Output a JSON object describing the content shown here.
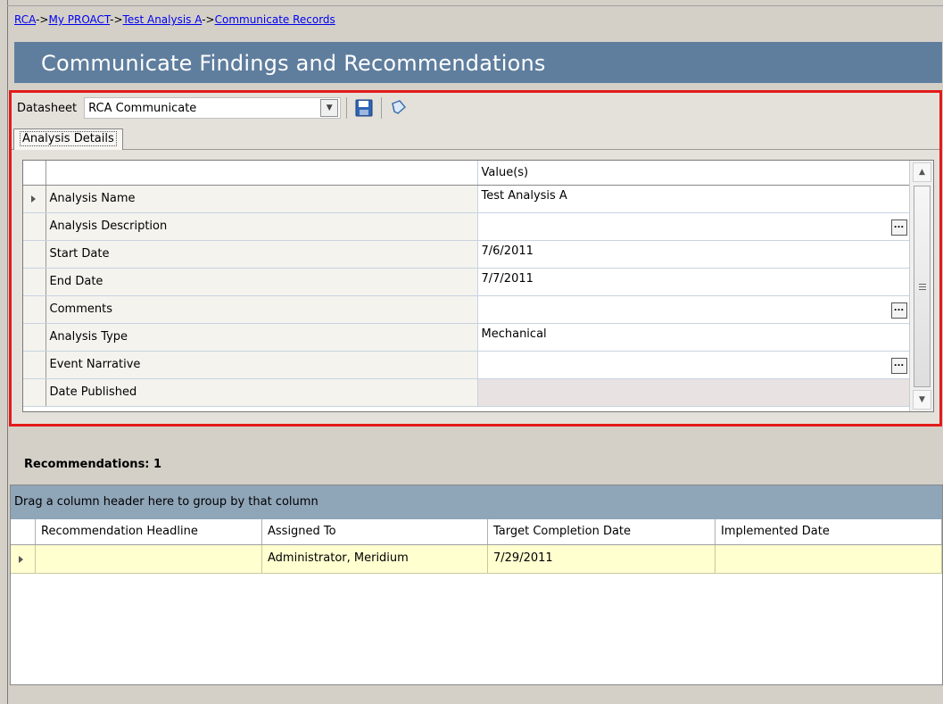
{
  "breadcrumb": {
    "items": [
      "RCA",
      "My PROACT",
      "Test Analysis A",
      "Communicate Records"
    ],
    "separator": "->"
  },
  "page_title": "Communicate Findings and Recommendations",
  "toolbar": {
    "datasheet_label": "Datasheet",
    "datasheet_value": "RCA Communicate",
    "dropdown_icon": "chevron-down-icon",
    "save_icon": "save-icon",
    "toggle_icon": "datasheet-toggle-icon"
  },
  "tabs": [
    {
      "label": "Analysis Details"
    }
  ],
  "details_grid": {
    "value_header": "Value(s)",
    "rows": [
      {
        "field": "Analysis Name",
        "value": "Test Analysis A"
      },
      {
        "field": "Analysis Description",
        "value": ""
      },
      {
        "field": "Start Date",
        "value": "7/6/2011"
      },
      {
        "field": "End Date",
        "value": "7/7/2011"
      },
      {
        "field": "Comments",
        "value": ""
      },
      {
        "field": "Analysis Type",
        "value": "Mechanical"
      },
      {
        "field": "Event Narrative",
        "value": ""
      },
      {
        "field": "Date Published",
        "value": ""
      }
    ],
    "ellipsis_label": "..."
  },
  "recommendations": {
    "title": "Recommendations:  1",
    "group_hint": "Drag a column header here to group by that column",
    "columns": [
      "Recommendation Headline",
      "Assigned To",
      "Target Completion Date",
      "Implemented Date"
    ],
    "rows": [
      {
        "headline": "",
        "assigned_to": "Administrator, Meridium",
        "target_date": "7/29/2011",
        "implemented": ""
      }
    ]
  },
  "colors": {
    "title_bar": "#5f7e9e",
    "highlight_frame": "#e31b1b",
    "group_bar": "#8fa5b8",
    "selected_row": "#ffffd0"
  }
}
